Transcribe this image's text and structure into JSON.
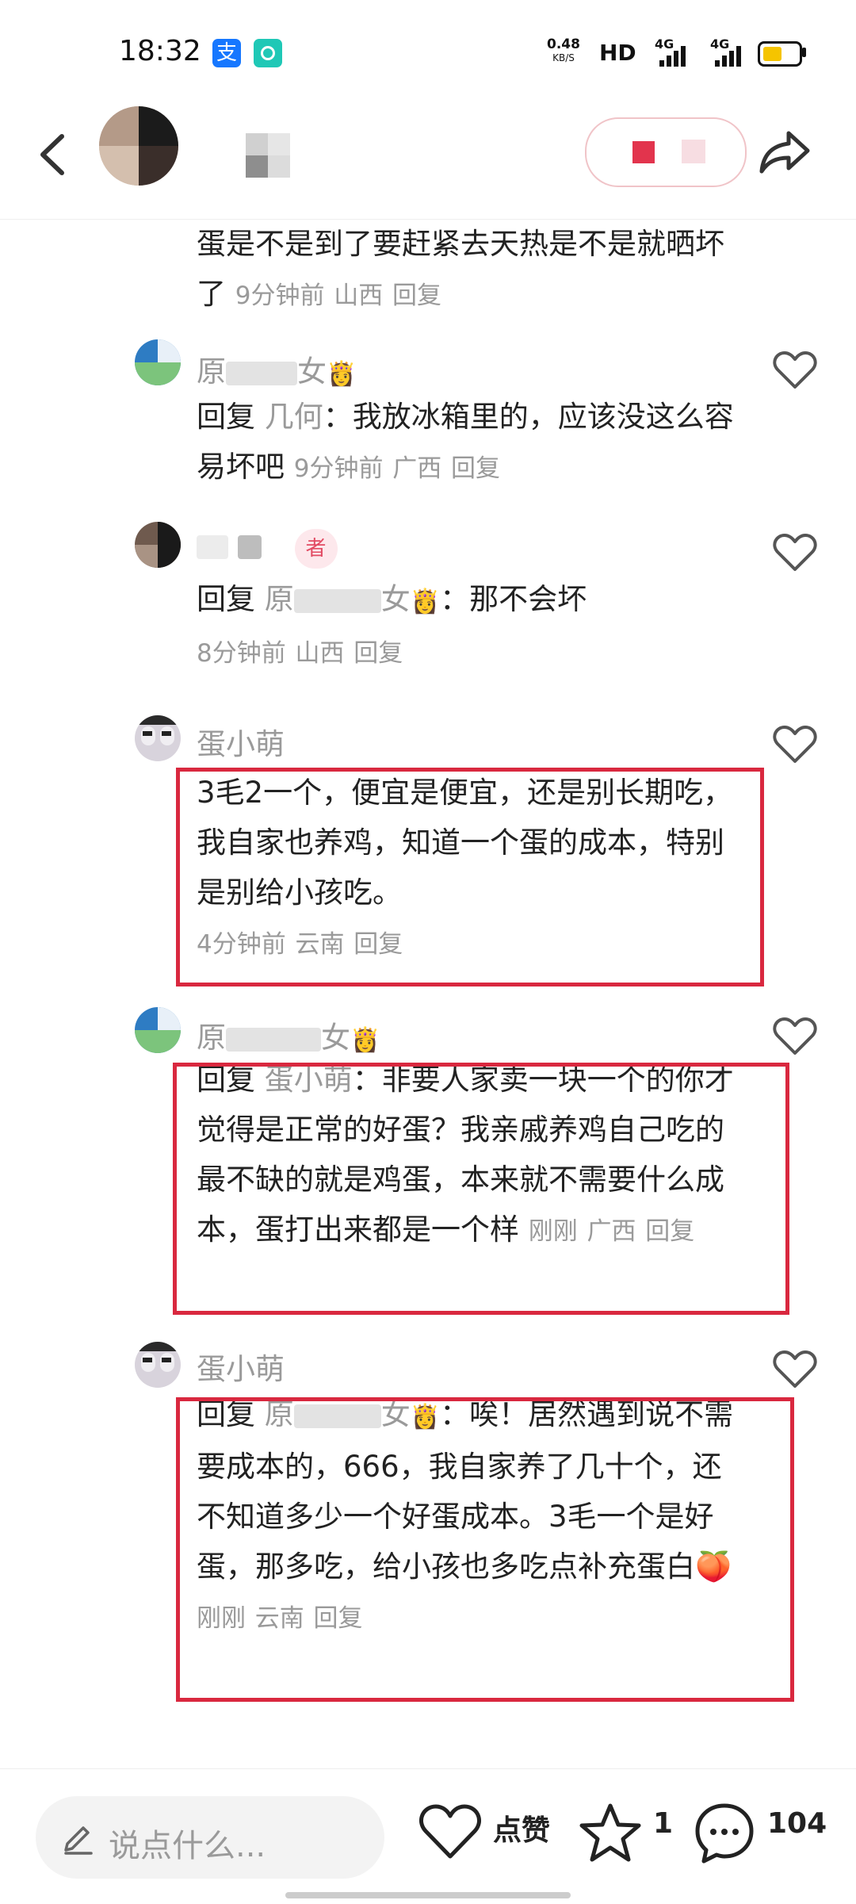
{
  "status_bar": {
    "time": "18:32",
    "alipay_icon": "支",
    "net_speed_value": "0.48",
    "net_speed_unit": "KB/S",
    "hd": "HD",
    "sim1": "4G",
    "sim2": "4G",
    "battery_level": 0.55
  },
  "header": {
    "back_icon": "chevron-left-icon",
    "share_icon": "share-arrow-icon"
  },
  "comments": [
    {
      "text": "蛋是不是到了要赶紧去天热是不是就晒坏了",
      "time": "9分钟前",
      "location": "山西",
      "reply_label": "回复"
    },
    {
      "name_start": "原",
      "name_end": "女",
      "crown": "👸",
      "reply_prefix": "回复",
      "reply_to": "几何",
      "text": "：我放冰箱里的，应该没这么容易坏吧",
      "time": "9分钟前",
      "location": "广西",
      "reply_label": "回复"
    },
    {
      "name_badge": "者",
      "reply_prefix": "回复",
      "reply_to_start": "原",
      "reply_to_end": "女",
      "crown": "👸",
      "text": "：那不会坏",
      "time": "8分钟前",
      "location": "山西",
      "reply_label": "回复"
    },
    {
      "name": "蛋小萌",
      "text": "3毛2一个，便宜是便宜，还是别长期吃，我自家也养鸡，知道一个蛋的成本，特别是别给小孩吃。",
      "time": "4分钟前",
      "location": "云南",
      "reply_label": "回复"
    },
    {
      "name_start": "原",
      "name_end": "女",
      "crown": "👸",
      "reply_prefix": "回复",
      "reply_to": "蛋小萌",
      "text": "：非要人家卖一块一个的你才觉得是正常的好蛋？我亲戚养鸡自己吃的最不缺的就是鸡蛋，本来就不需要什么成本，蛋打出来都是一个样",
      "time": "刚刚",
      "location": "广西",
      "reply_label": "回复"
    },
    {
      "name": "蛋小萌",
      "reply_prefix": "回复",
      "reply_to_start": "原",
      "reply_to_end": "女",
      "crown": "👸",
      "text": "：唉！居然遇到说不需要成本的，666，我自家养了几十个，还不知道多少一个好蛋成本。3毛一个是好蛋，那多吃，给小孩也多吃点补充蛋白",
      "emoji": "🍑",
      "time": "刚刚",
      "location": "云南",
      "reply_label": "回复"
    }
  ],
  "bottom_bar": {
    "input_placeholder": "说点什么...",
    "like_label": "点赞",
    "star_count": "1",
    "comment_count": "104"
  }
}
